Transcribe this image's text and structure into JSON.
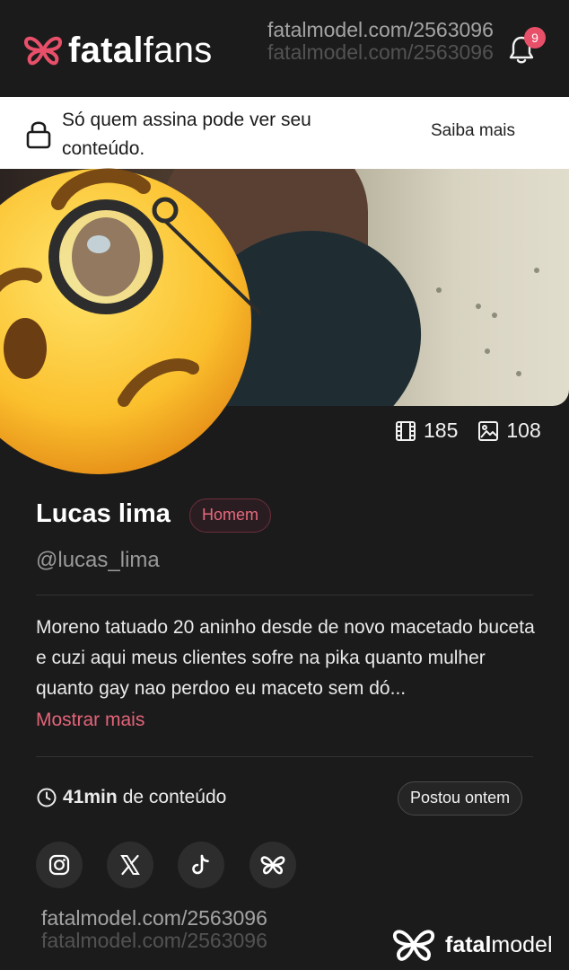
{
  "header": {
    "brand_bold": "fatal",
    "brand_light": "fans",
    "watermark": "fatalmodel.com/2563096",
    "notifications_count": "9"
  },
  "banner": {
    "message": "Só quem assina pode ver seu conteúdo.",
    "link_label": "Saiba mais"
  },
  "stats": {
    "videos_count": "185",
    "photos_count": "108"
  },
  "profile": {
    "name": "Lucas lima",
    "tag": "Homem",
    "handle": "@lucas_lima",
    "bio": "Moreno tatuado 20 aninho desde de novo macetado buceta e cuzi aqui meus clientes sofre na pika quanto mulher quanto gay nao perdoo eu maceto sem dó...",
    "show_more_label": "Mostrar mais"
  },
  "content": {
    "duration_value": "41min",
    "duration_suffix": "de conteúdo",
    "posted_label": "Postou ontem"
  },
  "social": [
    "instagram-icon",
    "x-icon",
    "tiktok-icon",
    "fatalmodel-icon"
  ],
  "footer": {
    "watermark": "fatalmodel.com/2563096",
    "brand_bold": "fatal",
    "brand_light": "model"
  },
  "colors": {
    "background": "#1c1b1c",
    "accent": "#e36478",
    "badge": "#e8506a"
  }
}
